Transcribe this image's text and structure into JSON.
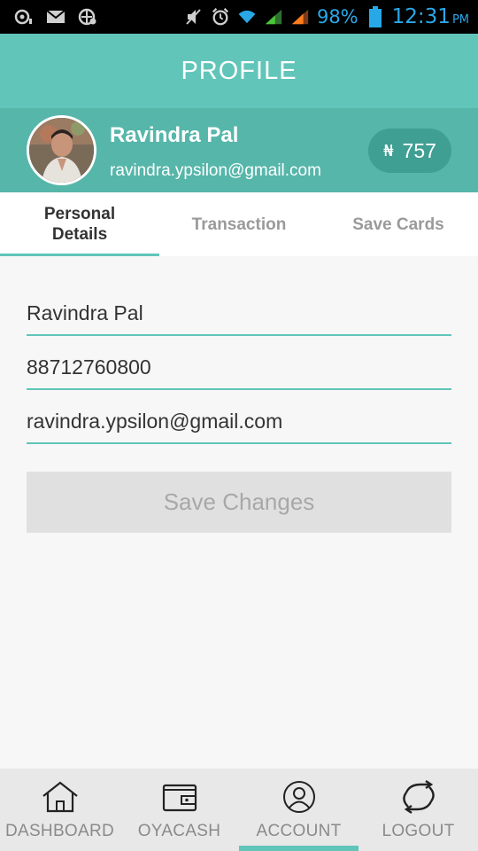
{
  "status_bar": {
    "battery_pct": "98%",
    "time": "12:31",
    "ampm": "PM",
    "accent_color": "#29a8e8"
  },
  "header": {
    "title": "PROFILE",
    "color": "#61c5b9"
  },
  "profile": {
    "name": "Ravindra Pal",
    "email": "ravindra.ypsilon@gmail.com",
    "points_currency": "₦",
    "points_value": "757"
  },
  "tabs": [
    {
      "label": "Personal Details",
      "active": true
    },
    {
      "label": "Transaction",
      "active": false
    },
    {
      "label": "Save Cards",
      "active": false
    }
  ],
  "form": {
    "name_value": "Ravindra Pal",
    "phone_value": "88712760800",
    "email_value": "ravindra.ypsilon@gmail.com",
    "save_label": "Save Changes"
  },
  "bottom_nav": [
    {
      "label": "DASHBOARD",
      "icon": "home-icon",
      "active": false
    },
    {
      "label": "OYACASH",
      "icon": "wallet-icon",
      "active": false
    },
    {
      "label": "ACCOUNT",
      "icon": "user-icon",
      "active": true
    },
    {
      "label": "LOGOUT",
      "icon": "refresh-icon",
      "active": false
    }
  ]
}
